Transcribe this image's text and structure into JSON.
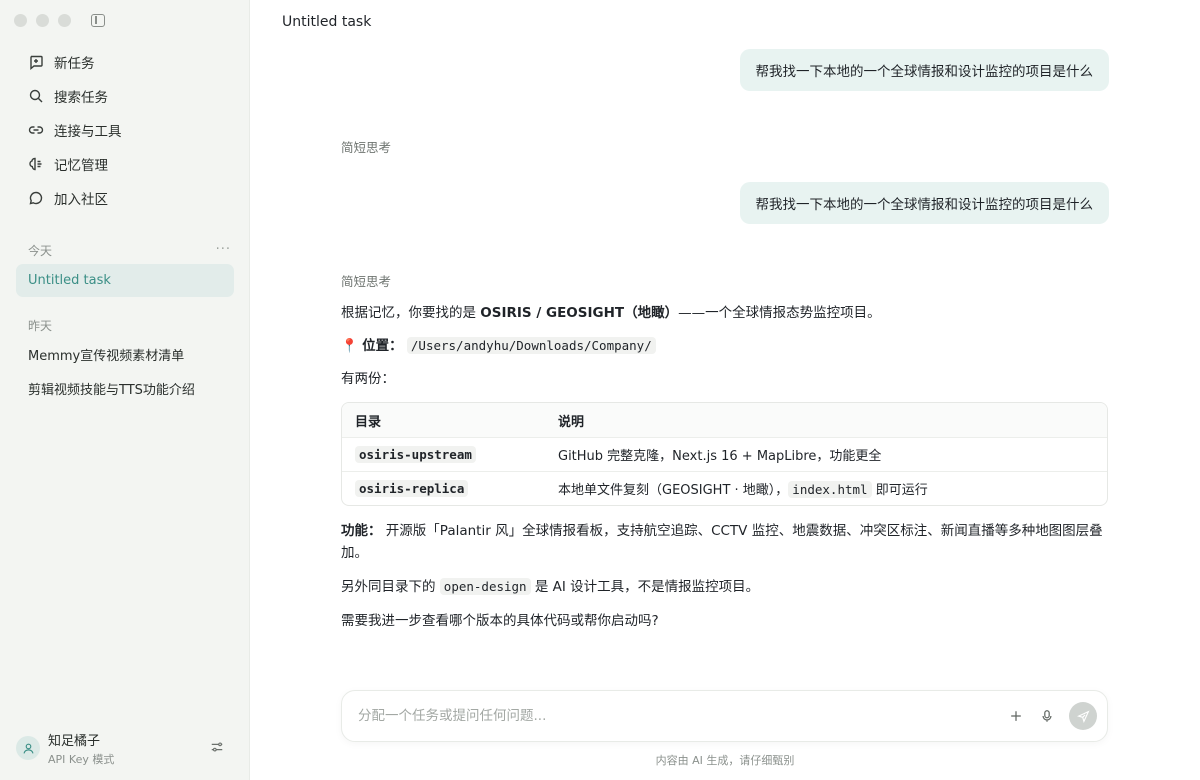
{
  "sidebar": {
    "nav": [
      {
        "label": "新任务",
        "icon": "plus-square-icon"
      },
      {
        "label": "搜索任务",
        "icon": "search-icon"
      },
      {
        "label": "连接与工具",
        "icon": "link-icon"
      },
      {
        "label": "记忆管理",
        "icon": "brain-icon"
      },
      {
        "label": "加入社区",
        "icon": "chat-bubble-icon"
      }
    ],
    "today_label": "今天",
    "today_more": "···",
    "today_tasks": [
      "Untitled task"
    ],
    "yesterday_label": "昨天",
    "yesterday_tasks": [
      "Memmy宣传视频素材清单",
      "剪辑视频技能与TTS功能介绍"
    ],
    "user": {
      "name": "知足橘子",
      "mode": "API Key 模式"
    }
  },
  "main": {
    "title": "Untitled task",
    "messages": {
      "user_1": "帮我找一下本地的一个全球情报和设计监控的项目是什么",
      "think_1": "简短思考",
      "user_2": "帮我找一下本地的一个全球情报和设计监控的项目是什么",
      "think_2": "简短思考"
    },
    "answer": {
      "intro_prefix": "根据记忆，你要找的是 ",
      "intro_bold": "OSIRIS / GEOSIGHT（地瞰）",
      "intro_suffix": "——一个全球情报态势监控项目。",
      "location_emoji": "📍",
      "location_label": "位置：",
      "location_path": "/Users/andyhu/Downloads/Company/",
      "copies": "有两份：",
      "table": {
        "headers": [
          "目录",
          "说明"
        ],
        "rows": [
          {
            "dir": "osiris-upstream",
            "desc": "GitHub 完整克隆，Next.js 16 + MapLibre，功能更全"
          },
          {
            "dir": "osiris-replica",
            "desc_prefix": "本地单文件复刻（GEOSIGHT · 地瞰），",
            "desc_code": "index.html",
            "desc_suffix": " 即可运行"
          }
        ]
      },
      "feature_label": "功能：",
      "feature_text": " 开源版「Palantir 风」全球情报看板，支持航空追踪、CCTV 监控、地震数据、冲突区标注、新闻直播等多种地图图层叠加。",
      "other_prefix": "另外同目录下的 ",
      "other_code": "open-design",
      "other_suffix": " 是 AI 设计工具，不是情报监控项目。",
      "question": "需要我进一步查看哪个版本的具体代码或帮你启动吗?"
    },
    "input": {
      "placeholder": "分配一个任务或提问任何问题..."
    },
    "disclaimer": "内容由 AI 生成，请仔细甄别"
  },
  "colors": {
    "accent": "#3b8f86",
    "bubble": "#e8f3f1",
    "sidebar_bg": "#f3f5f2"
  }
}
